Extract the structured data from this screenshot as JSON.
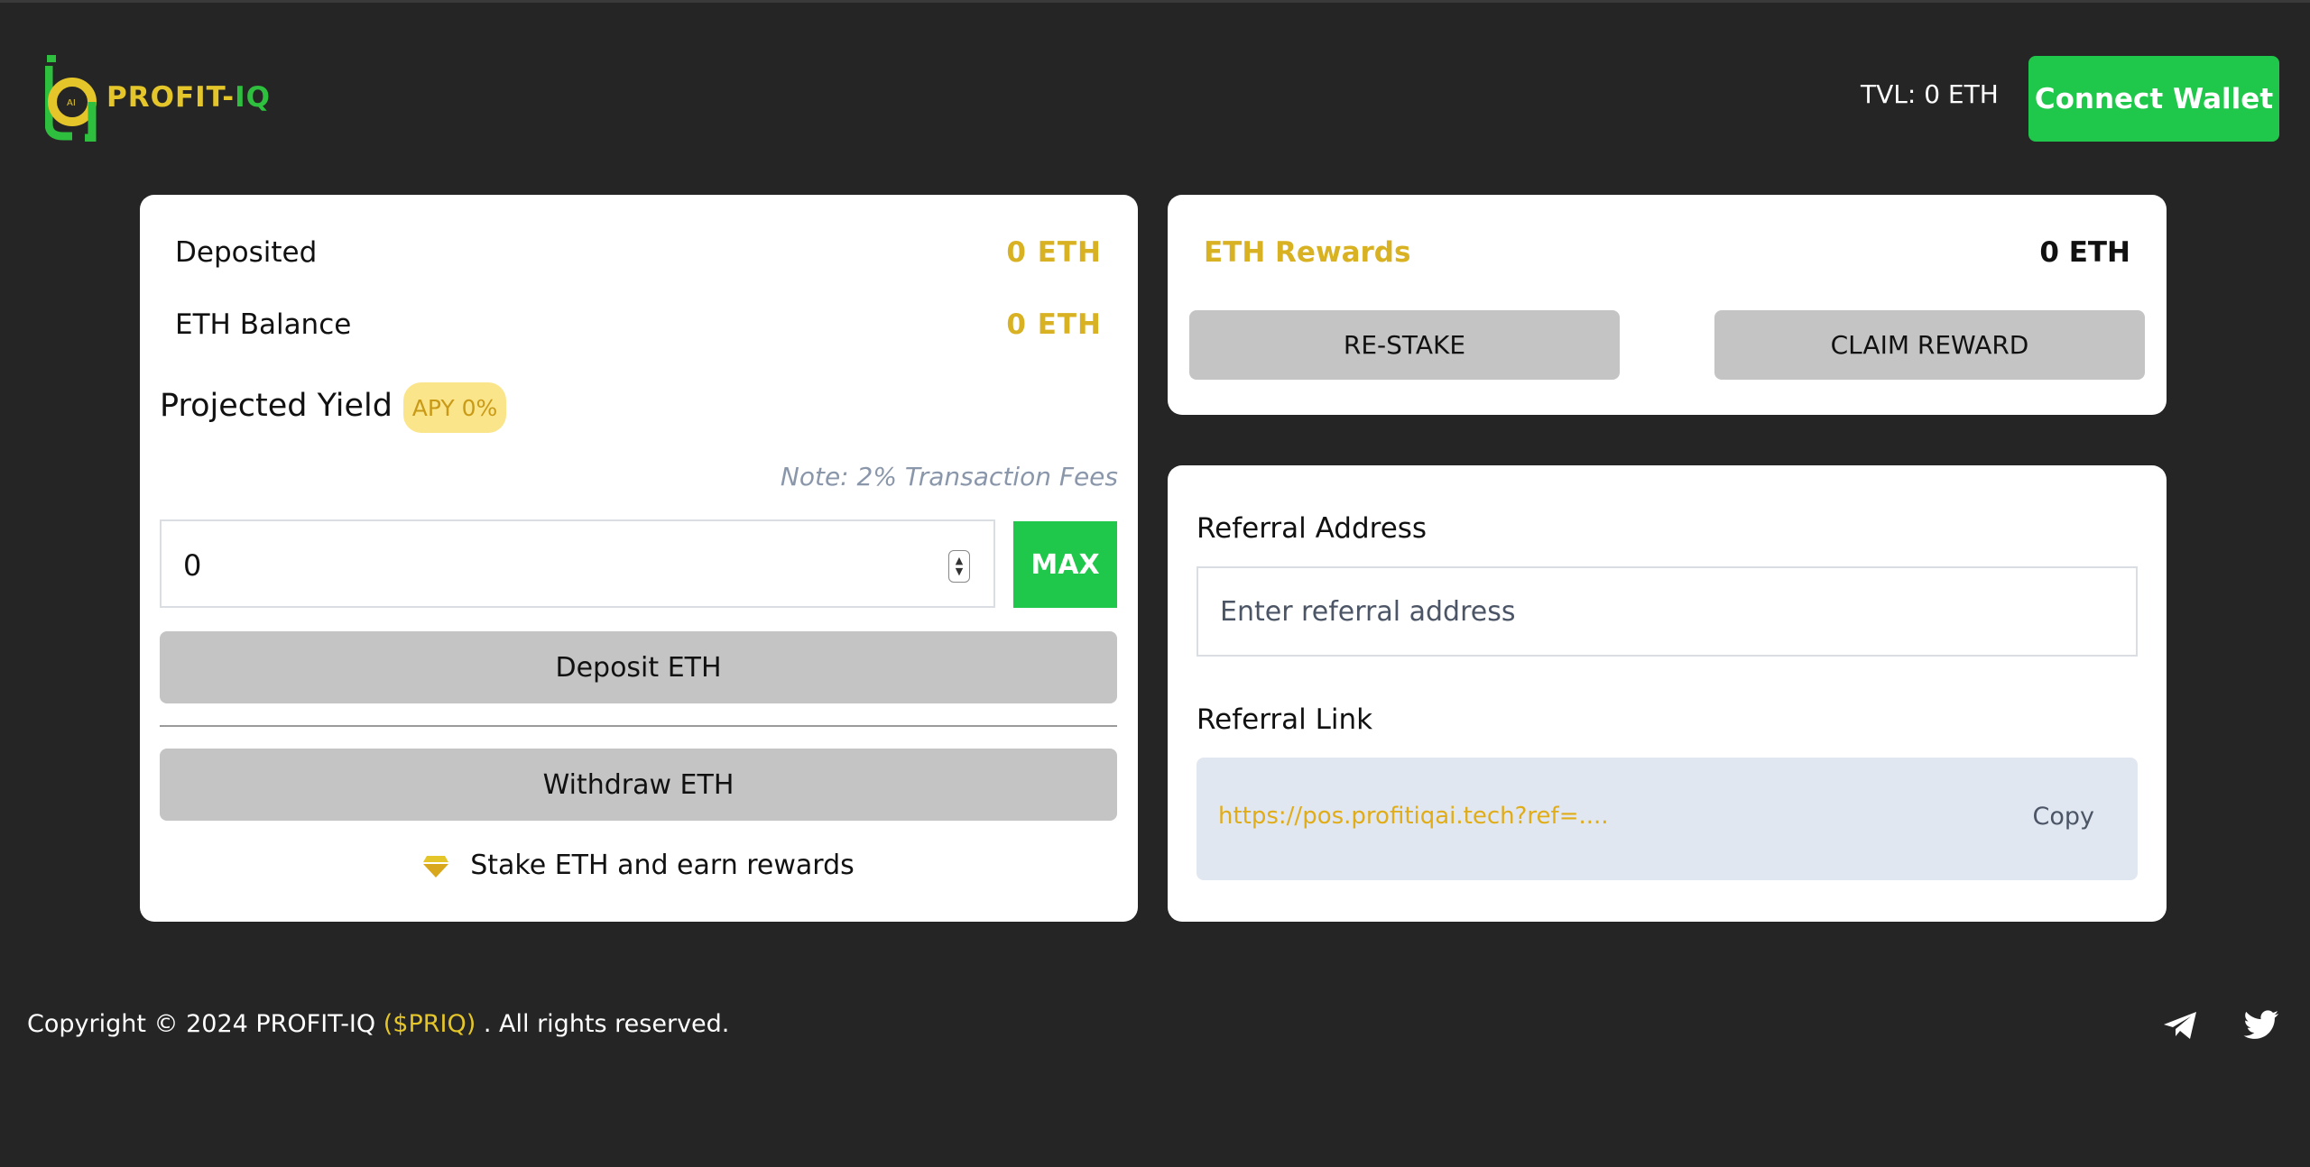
{
  "header": {
    "logo_text_primary": "PROFIT-",
    "logo_text_secondary": "IQ",
    "tvl": "TVL: 0 ETH",
    "connect_label": "Connect Wallet"
  },
  "stake_card": {
    "deposited_label": "Deposited",
    "deposited_value": "0 ETH",
    "balance_label": "ETH Balance",
    "balance_value": "0 ETH",
    "yield_label": "Projected Yield",
    "apy_badge": "APY 0%",
    "note": "Note: 2% Transaction Fees",
    "amount_value": "0",
    "max_label": "MAX",
    "deposit_label": "Deposit ETH",
    "withdraw_label": "Withdraw ETH",
    "stake_text": "Stake ETH and earn rewards",
    "stake_icon": "diamond-icon"
  },
  "rewards_card": {
    "label": "ETH Rewards",
    "value": "0 ETH",
    "restake_label": "RE-STAKE",
    "claim_label": "CLAIM REWARD"
  },
  "referral_card": {
    "address_label": "Referral Address",
    "address_placeholder": "Enter referral address",
    "link_label": "Referral Link",
    "link_value": "https://pos.profitiqai.tech?ref=....",
    "copy_label": "Copy"
  },
  "footer": {
    "copyright_pre": "Copyright © 2024 PROFIT-IQ",
    "ticker": "($PRIQ)",
    "copyright_post": ". All rights reserved.",
    "icons": [
      "telegram-icon",
      "twitter-icon"
    ]
  },
  "colors": {
    "background": "#252525",
    "accent_green": "#1fc74a",
    "accent_gold": "#d9b223",
    "button_gray": "#c4c4c4"
  }
}
